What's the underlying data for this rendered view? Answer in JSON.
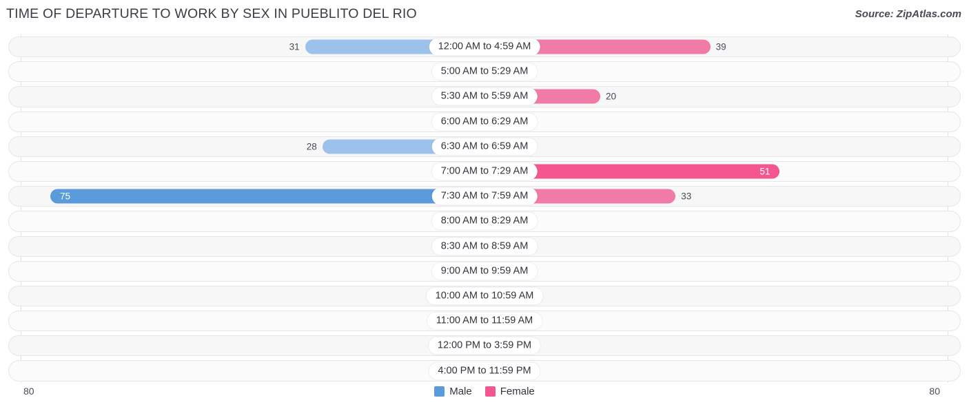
{
  "header": {
    "title": "TIME OF DEPARTURE TO WORK BY SEX IN PUEBLITO DEL RIO",
    "source": "Source: ZipAtlas.com"
  },
  "legend": {
    "male_label": "Male",
    "female_label": "Female",
    "male_color": "#5b9bdb",
    "female_color": "#f4578f"
  },
  "axis": {
    "left_end": "80",
    "right_end": "80"
  },
  "chart_data": {
    "type": "bar",
    "orientation": "horizontal-diverging",
    "title": "TIME OF DEPARTURE TO WORK BY SEX IN PUEBLITO DEL RIO",
    "xlabel": "",
    "ylabel": "",
    "xlim": [
      -80,
      80
    ],
    "axis_left_max": 80,
    "axis_right_max": 80,
    "grid": true,
    "legend_position": "bottom-center",
    "categories": [
      "12:00 AM to 4:59 AM",
      "5:00 AM to 5:29 AM",
      "5:30 AM to 5:59 AM",
      "6:00 AM to 6:29 AM",
      "6:30 AM to 6:59 AM",
      "7:00 AM to 7:29 AM",
      "7:30 AM to 7:59 AM",
      "8:00 AM to 8:29 AM",
      "8:30 AM to 8:59 AM",
      "9:00 AM to 9:59 AM",
      "10:00 AM to 10:59 AM",
      "11:00 AM to 11:59 AM",
      "12:00 PM to 3:59 PM",
      "4:00 PM to 11:59 PM"
    ],
    "series": [
      {
        "name": "Male",
        "color": "#5b9bdb",
        "values": [
          31,
          0,
          0,
          0,
          28,
          0,
          75,
          0,
          0,
          0,
          0,
          0,
          0,
          0
        ]
      },
      {
        "name": "Female",
        "color": "#f4578f",
        "values": [
          39,
          0,
          20,
          0,
          0,
          51,
          33,
          0,
          0,
          0,
          0,
          0,
          0,
          0
        ]
      }
    ]
  },
  "rows": [
    {
      "label": "12:00 AM to 4:59 AM",
      "male": "31",
      "female": "39"
    },
    {
      "label": "5:00 AM to 5:29 AM",
      "male": "0",
      "female": "0"
    },
    {
      "label": "5:30 AM to 5:59 AM",
      "male": "0",
      "female": "20"
    },
    {
      "label": "6:00 AM to 6:29 AM",
      "male": "0",
      "female": "0"
    },
    {
      "label": "6:30 AM to 6:59 AM",
      "male": "28",
      "female": "0"
    },
    {
      "label": "7:00 AM to 7:29 AM",
      "male": "0",
      "female": "51"
    },
    {
      "label": "7:30 AM to 7:59 AM",
      "male": "75",
      "female": "33"
    },
    {
      "label": "8:00 AM to 8:29 AM",
      "male": "0",
      "female": "0"
    },
    {
      "label": "8:30 AM to 8:59 AM",
      "male": "0",
      "female": "0"
    },
    {
      "label": "9:00 AM to 9:59 AM",
      "male": "0",
      "female": "0"
    },
    {
      "label": "10:00 AM to 10:59 AM",
      "male": "0",
      "female": "0"
    },
    {
      "label": "11:00 AM to 11:59 AM",
      "male": "0",
      "female": "0"
    },
    {
      "label": "12:00 PM to 3:59 PM",
      "male": "0",
      "female": "0"
    },
    {
      "label": "4:00 PM to 11:59 PM",
      "male": "0",
      "female": "0"
    }
  ]
}
